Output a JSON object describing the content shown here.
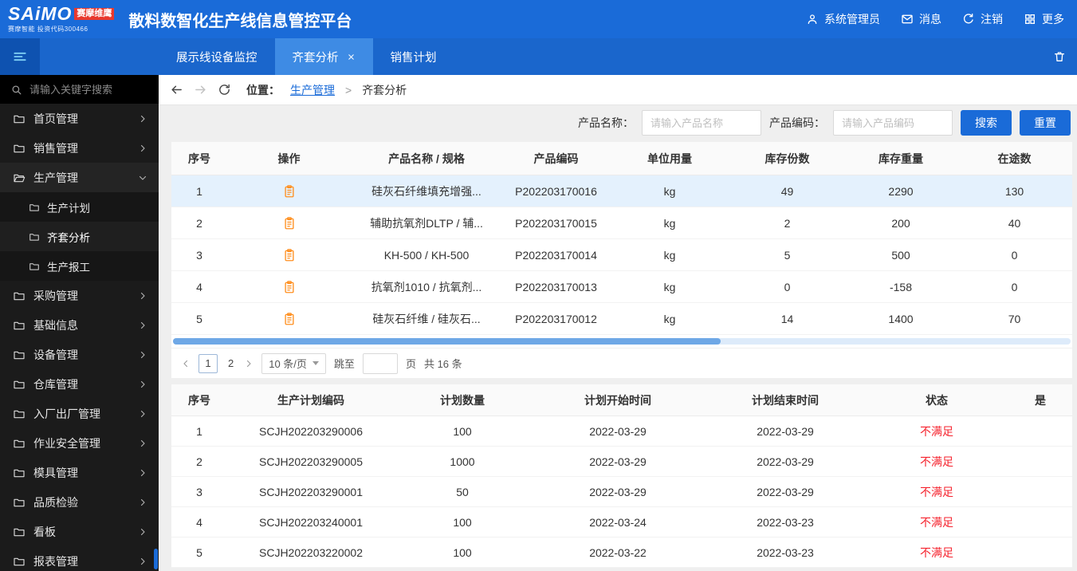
{
  "topbar": {
    "logo_text": "SAiMO",
    "logo_badge": "赛摩维鹰",
    "logo_sub": "赛摩智能 投资代码300466",
    "title": "散料数智化生产线信息管控平台",
    "user_label": "系统管理员",
    "messages_label": "消息",
    "logout_label": "注销",
    "more_label": "更多"
  },
  "tabbar": {
    "tabs": [
      {
        "label": "展示线设备监控",
        "active": false
      },
      {
        "label": "齐套分析",
        "active": true
      },
      {
        "label": "销售计划",
        "active": false
      }
    ]
  },
  "sidebar": {
    "search_placeholder": "请输入关键字搜索",
    "items": [
      {
        "label": "首页管理"
      },
      {
        "label": "销售管理"
      },
      {
        "label": "生产管理",
        "expanded": true,
        "children": [
          {
            "label": "生产计划"
          },
          {
            "label": "齐套分析",
            "active": true
          },
          {
            "label": "生产报工"
          }
        ]
      },
      {
        "label": "采购管理"
      },
      {
        "label": "基础信息"
      },
      {
        "label": "设备管理"
      },
      {
        "label": "仓库管理"
      },
      {
        "label": "入厂出厂管理"
      },
      {
        "label": "作业安全管理"
      },
      {
        "label": "模具管理"
      },
      {
        "label": "品质检验"
      },
      {
        "label": "看板"
      },
      {
        "label": "报表管理"
      }
    ]
  },
  "breadcrumb": {
    "location_label": "位置：",
    "parent": "生产管理",
    "separator": ">",
    "current": "齐套分析"
  },
  "filters": {
    "product_name_label": "产品名称：",
    "product_name_placeholder": "请输入产品名称",
    "product_code_label": "产品编码：",
    "product_code_placeholder": "请输入产品编码",
    "search_button": "搜索",
    "reset_button": "重置"
  },
  "products_table": {
    "action_icon": "clipboard-icon",
    "headers": [
      "序号",
      "操作",
      "产品名称 / 规格",
      "产品编码",
      "单位用量",
      "库存份数",
      "库存重量",
      "在途数"
    ],
    "rows": [
      {
        "seq": "1",
        "name": "硅灰石纤维填充增强...",
        "code": "P202203170016",
        "unit": "kg",
        "stock_count": "49",
        "stock_weight": "2290",
        "in_transit": "130"
      },
      {
        "seq": "2",
        "name": "辅助抗氧剂DLTP / 辅...",
        "code": "P202203170015",
        "unit": "kg",
        "stock_count": "2",
        "stock_weight": "200",
        "in_transit": "40"
      },
      {
        "seq": "3",
        "name": "KH-500 / KH-500",
        "code": "P202203170014",
        "unit": "kg",
        "stock_count": "5",
        "stock_weight": "500",
        "in_transit": "0"
      },
      {
        "seq": "4",
        "name": "抗氧剂1010 / 抗氧剂...",
        "code": "P202203170013",
        "unit": "kg",
        "stock_count": "0",
        "stock_weight": "-158",
        "in_transit": "0"
      },
      {
        "seq": "5",
        "name": "硅灰石纤维 / 硅灰石...",
        "code": "P202203170012",
        "unit": "kg",
        "stock_count": "14",
        "stock_weight": "1400",
        "in_transit": "70"
      }
    ]
  },
  "pagination": {
    "pages": [
      "1",
      "2"
    ],
    "current_page": "1",
    "page_size": "10 条/页",
    "jump_label": "跳至",
    "page_unit": "页",
    "total_text": "共 16 条"
  },
  "plans_table": {
    "headers": [
      "序号",
      "生产计划编码",
      "计划数量",
      "计划开始时间",
      "计划结束时间",
      "状态",
      "是"
    ],
    "rows": [
      {
        "seq": "1",
        "plan_code": "SCJH202203290006",
        "qty": "100",
        "start": "2022-03-29",
        "end": "2022-03-29",
        "status": "不满足"
      },
      {
        "seq": "2",
        "plan_code": "SCJH202203290005",
        "qty": "1000",
        "start": "2022-03-29",
        "end": "2022-03-29",
        "status": "不满足"
      },
      {
        "seq": "3",
        "plan_code": "SCJH202203290001",
        "qty": "50",
        "start": "2022-03-29",
        "end": "2022-03-29",
        "status": "不满足"
      },
      {
        "seq": "4",
        "plan_code": "SCJH202203240001",
        "qty": "100",
        "start": "2022-03-24",
        "end": "2022-03-23",
        "status": "不满足"
      },
      {
        "seq": "5",
        "plan_code": "SCJH202203220002",
        "qty": "100",
        "start": "2022-03-22",
        "end": "2022-03-23",
        "status": "不满足"
      }
    ]
  },
  "colors": {
    "topbar_blue": "#1A6BD8",
    "active_tab_blue": "#3E8BE4",
    "accent_blue": "#1A6BD8",
    "status_red": "#F5222D",
    "action_icon_orange": "#FF8F1F",
    "selected_row_blue": "#E4F1FD"
  }
}
